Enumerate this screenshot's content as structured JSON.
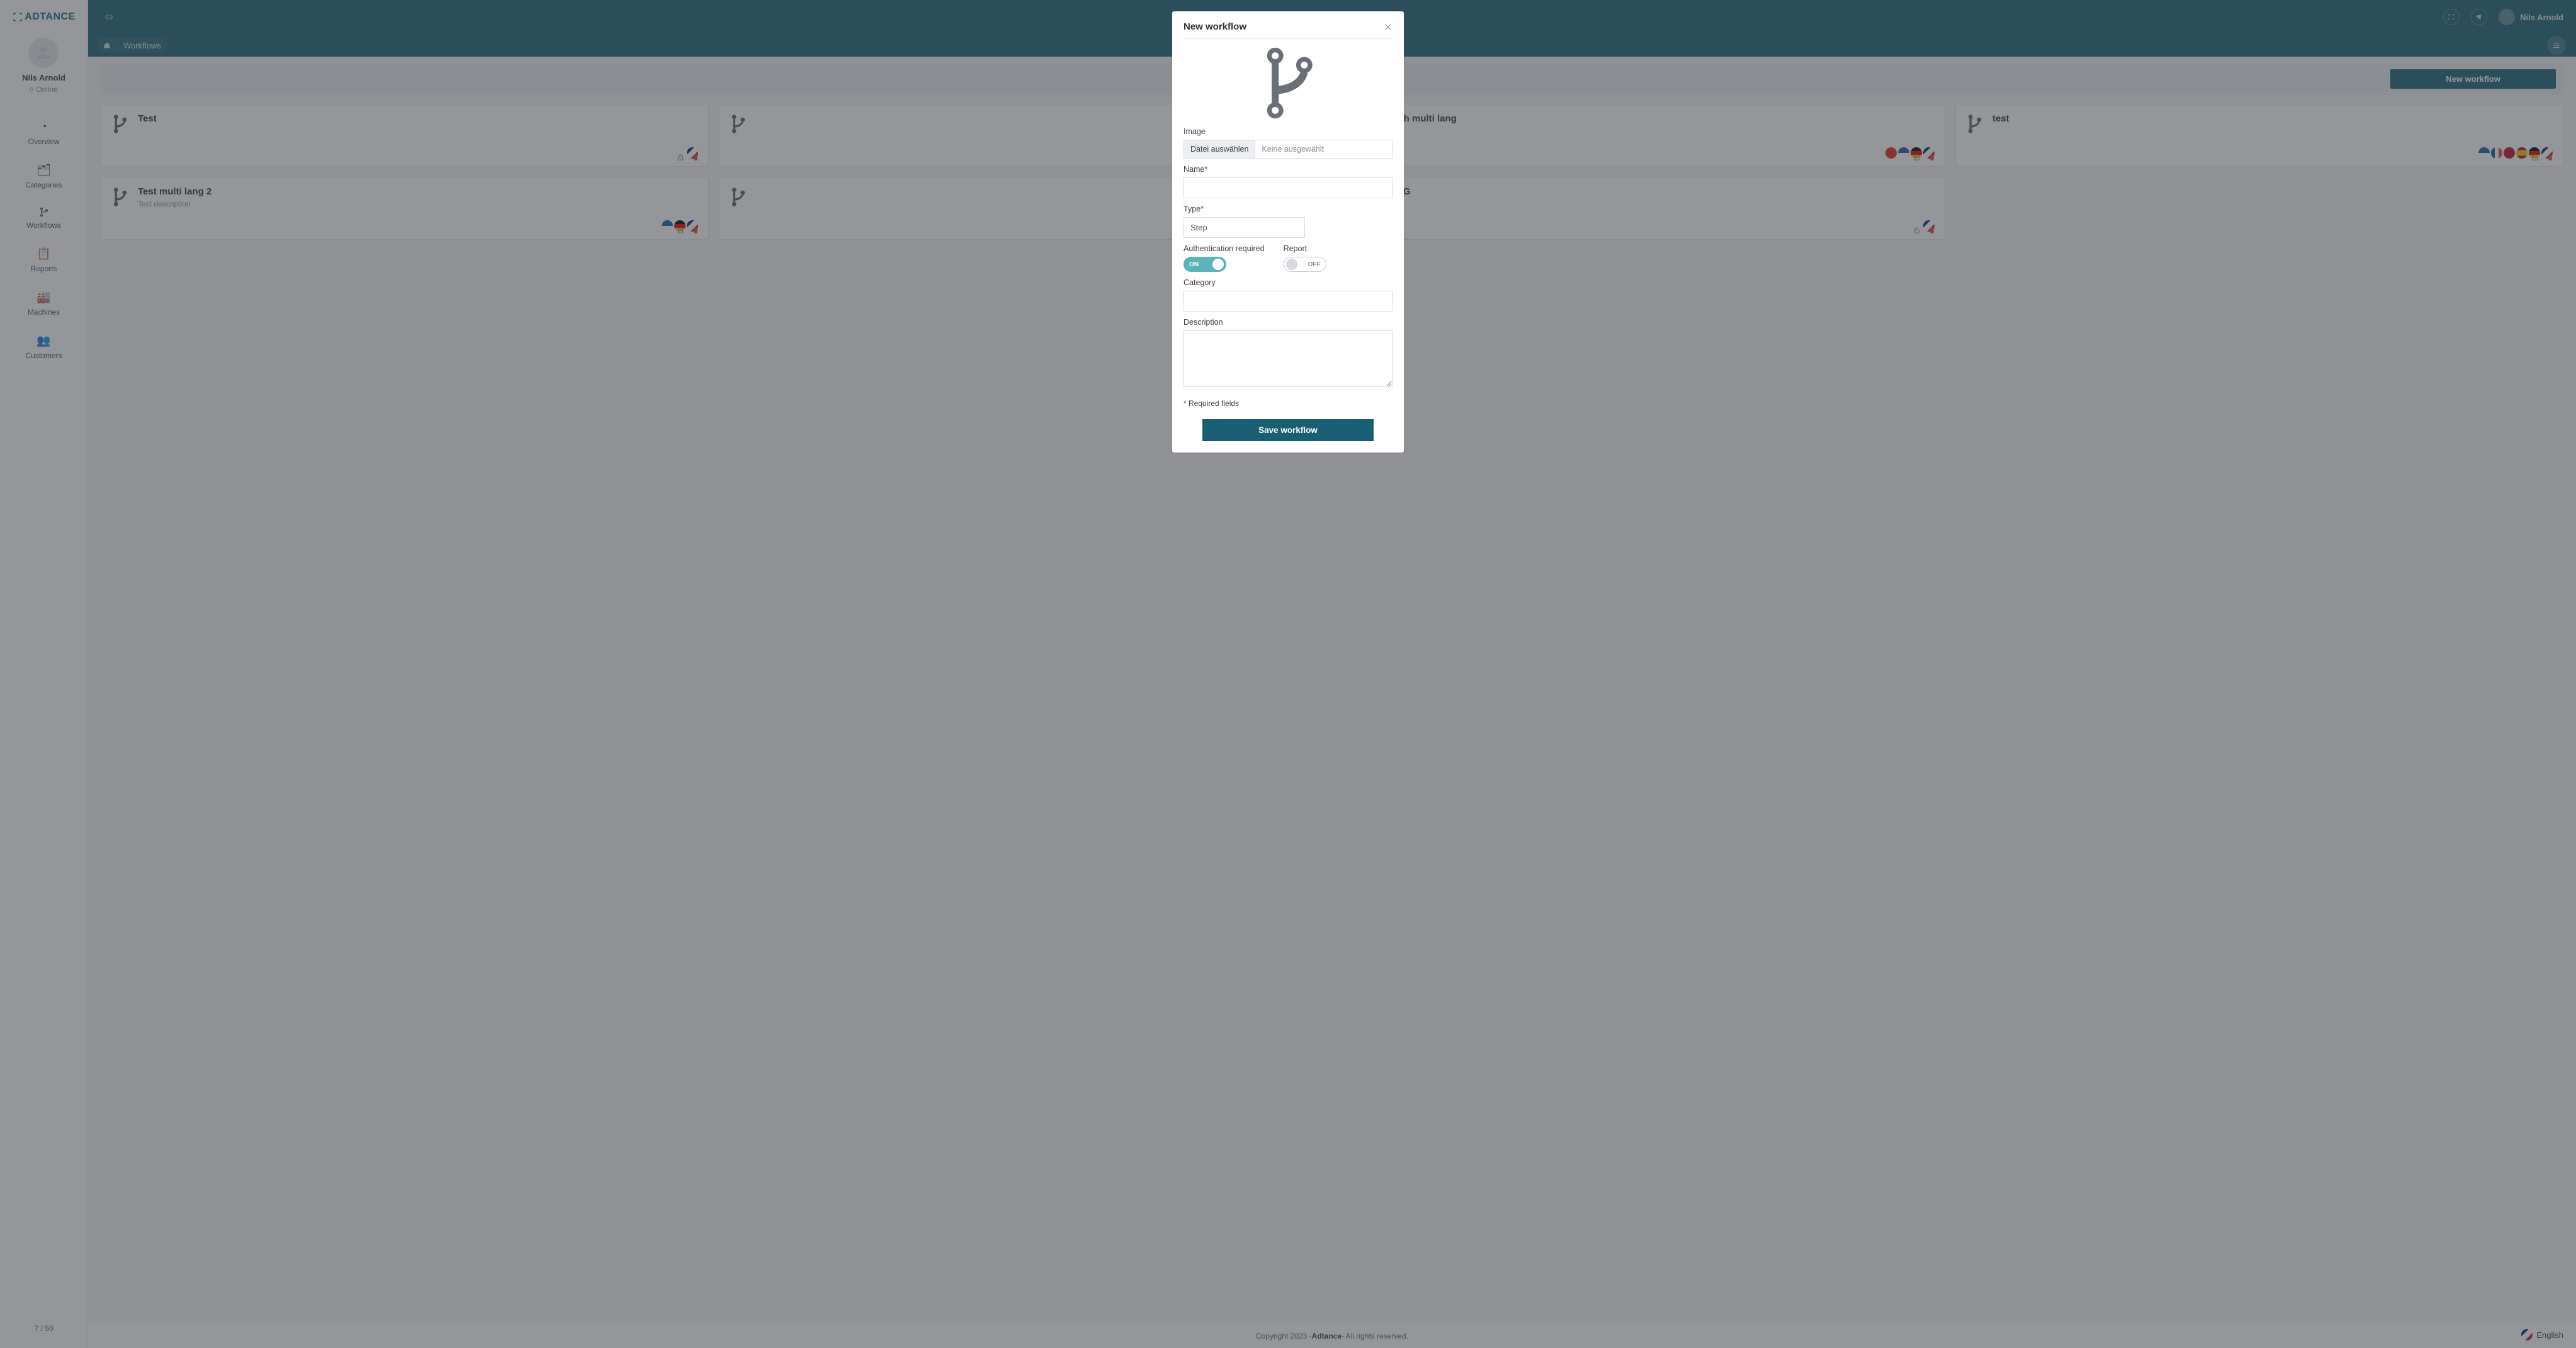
{
  "brand": "ADTANCE",
  "user": {
    "name": "Nils Arnold",
    "status": "Online"
  },
  "sidebar": {
    "items": [
      {
        "label": "Overview",
        "icon": "dashboard-icon"
      },
      {
        "label": "Categories",
        "icon": "folder-icon"
      },
      {
        "label": "Workflows",
        "icon": "branch-icon"
      },
      {
        "label": "Reports",
        "icon": "clipboard-icon"
      },
      {
        "label": "Machines",
        "icon": "factory-icon"
      },
      {
        "label": "Customers",
        "icon": "users-icon"
      }
    ],
    "footer_count": "7 / 50"
  },
  "topbar": {
    "username": "Nils Arnold"
  },
  "breadcrumb": {
    "current": "Workflows"
  },
  "actions": {
    "new_workflow": "New workflow"
  },
  "cards": [
    {
      "title": "Test",
      "desc": "",
      "flags": [
        "gb"
      ],
      "locked": true
    },
    {
      "title": "",
      "desc": "",
      "flags": [],
      "locked": true
    },
    {
      "title": "est with multi lang",
      "desc": "",
      "flags": [
        "cn",
        "gr",
        "de",
        "gb"
      ],
      "locked": true
    },
    {
      "title": "test",
      "desc": "",
      "flags": [
        "gr",
        "fr",
        "no",
        "es",
        "de",
        "gb"
      ],
      "locked": false
    },
    {
      "title": "Test multi lang 2",
      "desc": "Test description",
      "flags": [
        "gr",
        "de",
        "gb"
      ],
      "locked": true
    },
    {
      "title": "",
      "desc": "",
      "flags": [],
      "locked": true
    },
    {
      "title": "emo KG",
      "desc": "",
      "flags": [
        "gb"
      ],
      "locked": false
    }
  ],
  "modal": {
    "title": "New workflow",
    "image_label": "Image",
    "file_button": "Datei auswählen",
    "file_none": "Keine ausgewählt",
    "name_label": "Name*",
    "type_label": "Type*",
    "type_value": "Step",
    "auth_label": "Authentication required",
    "auth_state": "ON",
    "report_label": "Report",
    "report_state": "OFF",
    "category_label": "Category",
    "description_label": "Description",
    "required_note": "* Required fields",
    "save_button": "Save workflow"
  },
  "footer": {
    "copyright_prefix": "Copyright 2023 - ",
    "brand": "Adtance",
    "copyright_suffix": " - All rights reserved."
  },
  "language": {
    "label": "English"
  }
}
